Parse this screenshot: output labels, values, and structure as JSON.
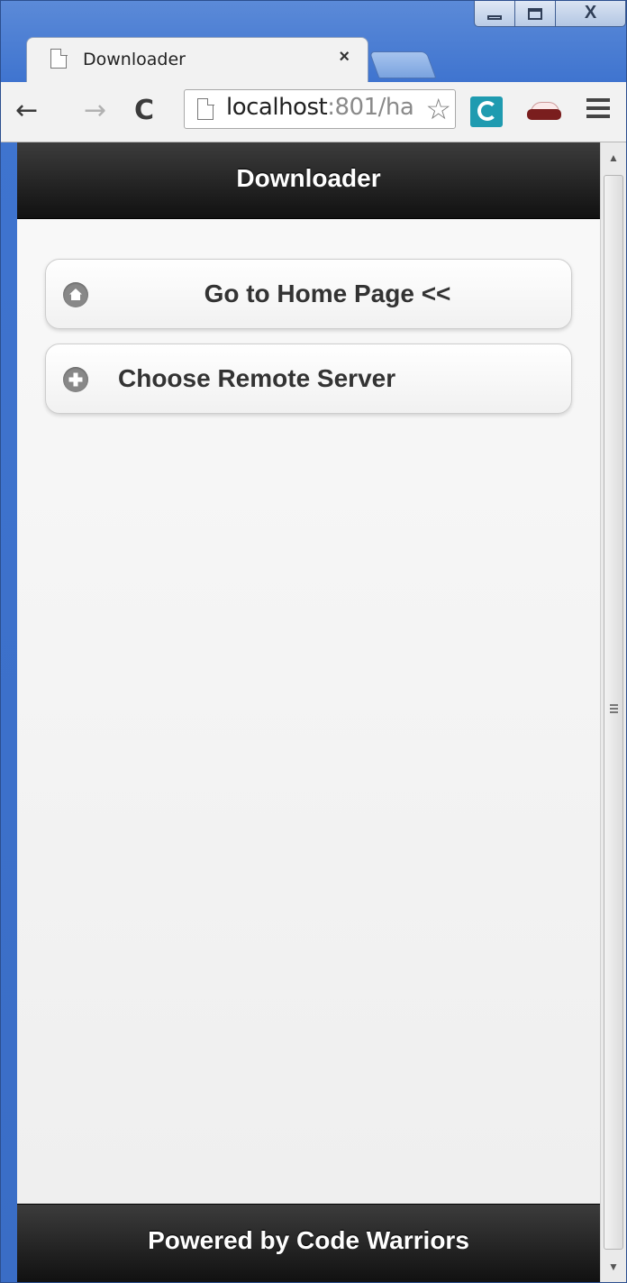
{
  "browser": {
    "tab": {
      "title": "Downloader",
      "close_label": "×"
    },
    "window_controls": {
      "close_label": "X"
    },
    "toolbar": {
      "back_label": "←",
      "forward_label": "→",
      "reload_label": "C",
      "url_host": "localhost",
      "url_rest": ":801/ha",
      "bookmark_star": "☆"
    },
    "icons": [
      "page-icon",
      "back-arrow-icon",
      "forward-arrow-icon",
      "reload-icon",
      "star-icon",
      "extension-icon",
      "incognito-mask-icon",
      "menu-icon"
    ]
  },
  "page": {
    "header": {
      "title": "Downloader"
    },
    "buttons": {
      "home": {
        "label": "Go to Home Page <<",
        "icon": "home-icon"
      },
      "server": {
        "label": "Choose Remote Server",
        "icon": "plus-icon"
      }
    },
    "footer": {
      "text": "Powered by Code Warriors"
    }
  },
  "colors": {
    "bar_dark": "#111111",
    "bar_text": "#ffffff",
    "button_icon": "#888888",
    "window_frame": "#3f74cf"
  }
}
